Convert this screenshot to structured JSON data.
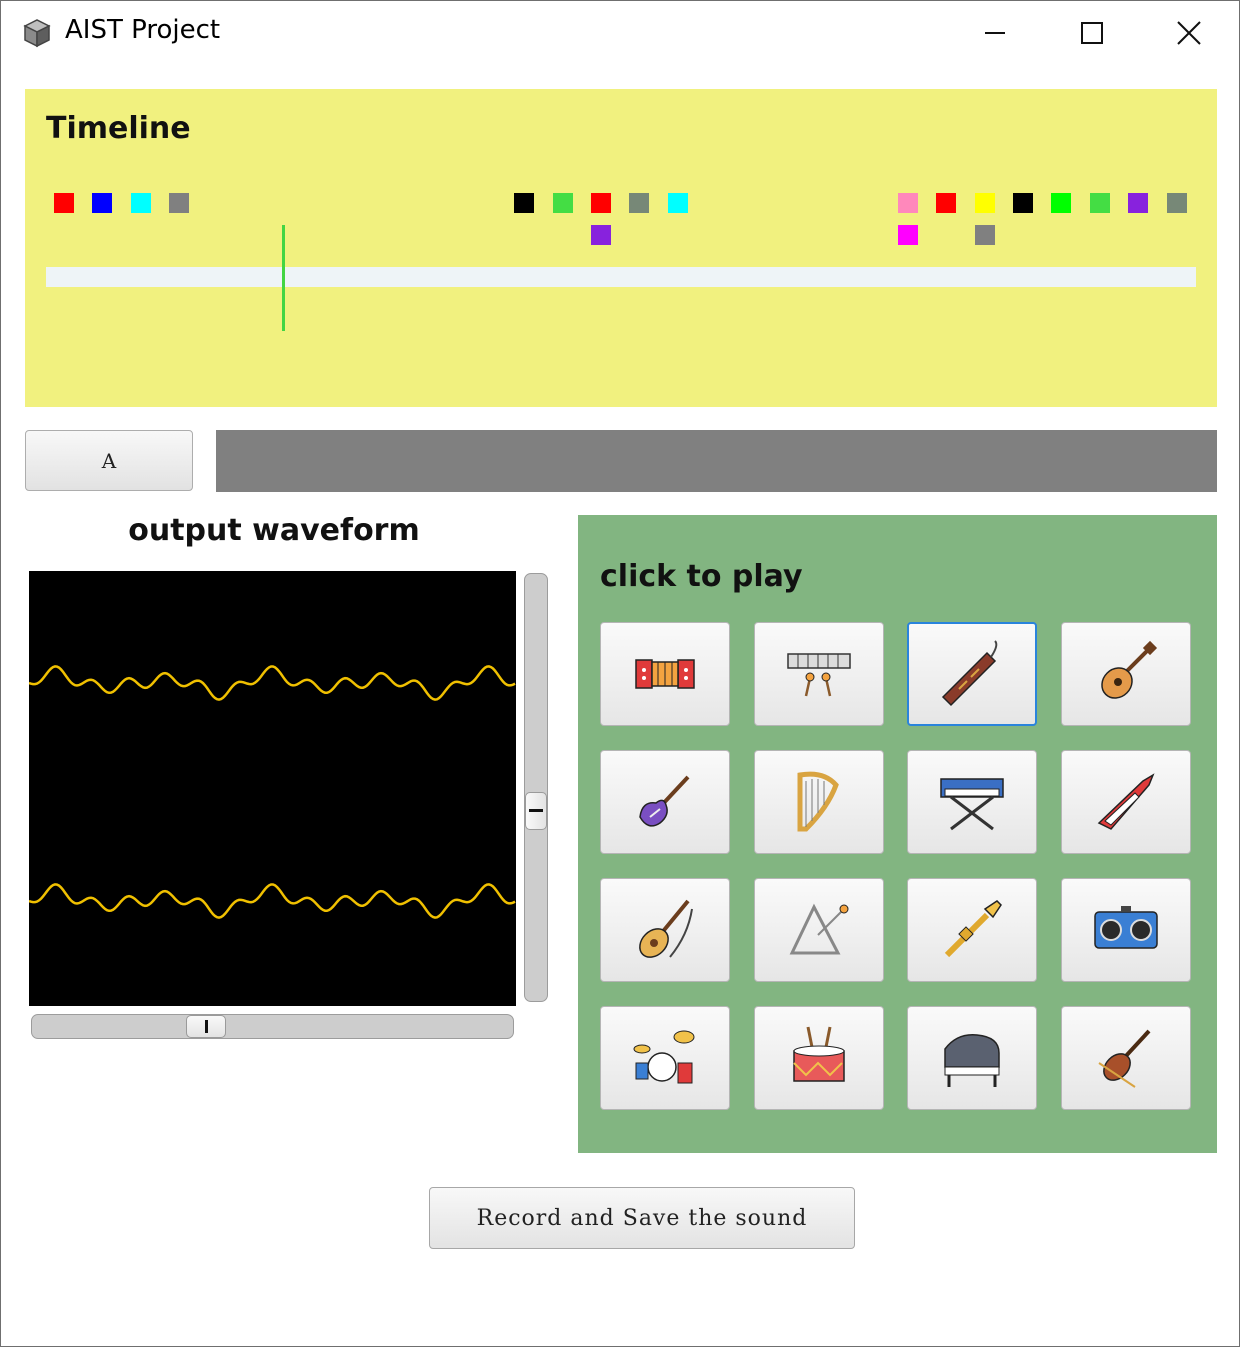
{
  "window": {
    "title": "AIST Project",
    "icon": "cube-icon"
  },
  "timeline": {
    "title": "Timeline",
    "cursor_position": 0.205,
    "cursor_color": "#43d543",
    "marks": [
      {
        "color": "#ff0000"
      },
      {
        "color": "#0000ff"
      },
      {
        "color": "#00ffff"
      },
      {
        "color": "#808080"
      },
      {
        "color": "#000000"
      },
      {
        "color": "#44dd44"
      },
      {
        "color": "#ff0000"
      },
      {
        "color": "#778877"
      },
      {
        "color": "#00ffff"
      },
      {
        "color": "#8822dd"
      },
      {
        "color": "#ff88bb"
      },
      {
        "color": "#ff00ff"
      },
      {
        "color": "#ff0000"
      },
      {
        "color": "#ffff00"
      },
      {
        "color": "#808080"
      },
      {
        "color": "#000000"
      },
      {
        "color": "#00ff00"
      },
      {
        "color": "#44dd44"
      },
      {
        "color": "#8822dd"
      },
      {
        "color": "#778877"
      }
    ]
  },
  "controls": {
    "key_label": "A",
    "key_bar_color": "#808080"
  },
  "waveform": {
    "title": "output waveform",
    "color": "#f0c000",
    "vertical_scroll": 0.56,
    "horizontal_scroll": 0.35
  },
  "instruments": {
    "title": "click to play",
    "items": [
      {
        "name": "accordion",
        "icon": "accordion-icon"
      },
      {
        "name": "xylophone",
        "icon": "xylophone-icon"
      },
      {
        "name": "bassoon",
        "icon": "bassoon-icon",
        "selected": true
      },
      {
        "name": "acoustic guitar",
        "icon": "acoustic-guitar-icon"
      },
      {
        "name": "electric guitar",
        "icon": "electric-guitar-icon"
      },
      {
        "name": "harp",
        "icon": "harp-icon"
      },
      {
        "name": "keyboard",
        "icon": "keyboard-icon"
      },
      {
        "name": "keytar",
        "icon": "keytar-icon"
      },
      {
        "name": "sitar",
        "icon": "sitar-icon"
      },
      {
        "name": "triangle",
        "icon": "triangle-icon"
      },
      {
        "name": "trumpet",
        "icon": "trumpet-icon"
      },
      {
        "name": "boombox",
        "icon": "boombox-icon"
      },
      {
        "name": "drum kit",
        "icon": "drum-kit-icon"
      },
      {
        "name": "snare drum",
        "icon": "snare-drum-icon"
      },
      {
        "name": "grand piano",
        "icon": "grand-piano-icon"
      },
      {
        "name": "violin",
        "icon": "violin-icon"
      }
    ]
  },
  "record": {
    "label": "Record and Save the sound"
  }
}
